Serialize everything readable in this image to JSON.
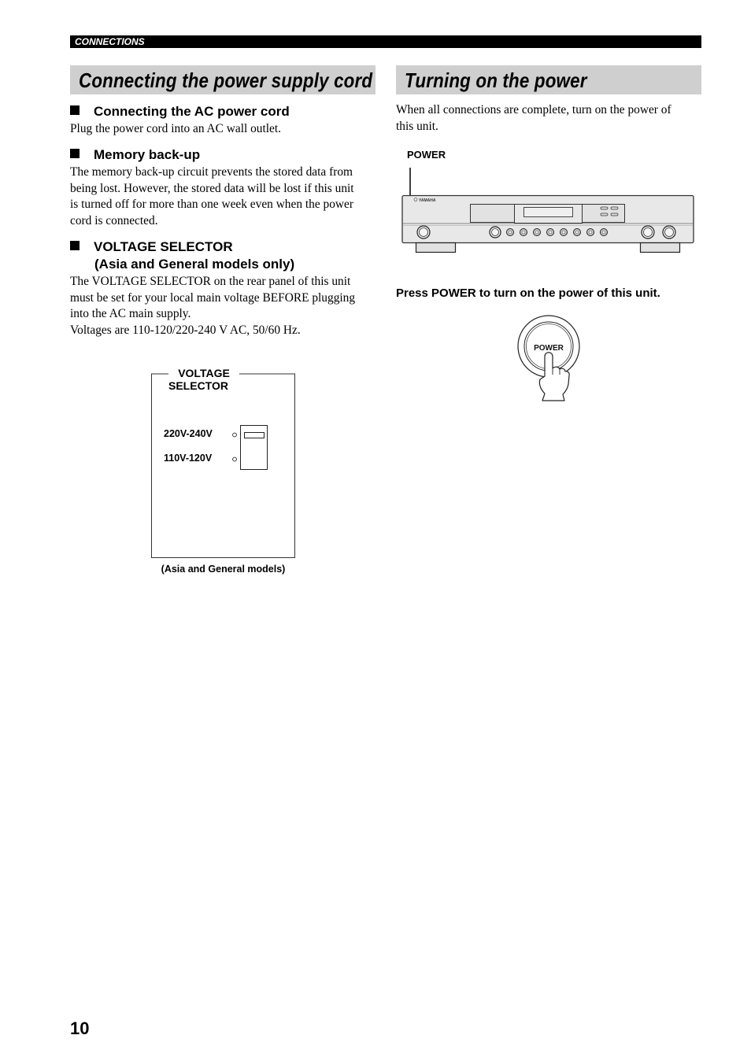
{
  "header": {
    "section_label": "CONNECTIONS"
  },
  "left_column": {
    "title": "Connecting the power supply cord",
    "sections": [
      {
        "heading": "Connecting the AC power cord",
        "body": [
          "Plug the power cord into an AC wall outlet."
        ]
      },
      {
        "heading": "Memory back-up",
        "body": [
          "The memory back-up circuit prevents the stored data from",
          "being lost. However, the stored data will be lost if this unit",
          "is turned off for more than one week even when the power",
          "cord is connected."
        ]
      },
      {
        "heading_lines": [
          "VOLTAGE SELECTOR",
          "(Asia and General models only)"
        ],
        "body": [
          "The VOLTAGE SELECTOR on the rear panel of this unit",
          "must be set for your local main voltage BEFORE plugging",
          "into the AC main supply.",
          "Voltages are 110-120/220-240 V AC, 50/60 Hz."
        ]
      }
    ],
    "voltage_figure": {
      "title_lines": [
        "VOLTAGE",
        "SELECTOR"
      ],
      "options": [
        "220V-240V",
        "110V-120V"
      ],
      "selected_option": "220V-240V",
      "caption": "(Asia and General models)"
    }
  },
  "right_column": {
    "title": "Turning on the power",
    "intro": [
      "When all connections are complete, turn on the power of",
      "this unit."
    ],
    "front_panel_figure": {
      "callout_label": "POWER",
      "brand": "YAMAHA",
      "knob_count": 8
    },
    "instruction": "Press POWER to turn on the power of this unit.",
    "button_figure": {
      "button_label": "POWER"
    }
  },
  "footer": {
    "page_number": "10"
  }
}
